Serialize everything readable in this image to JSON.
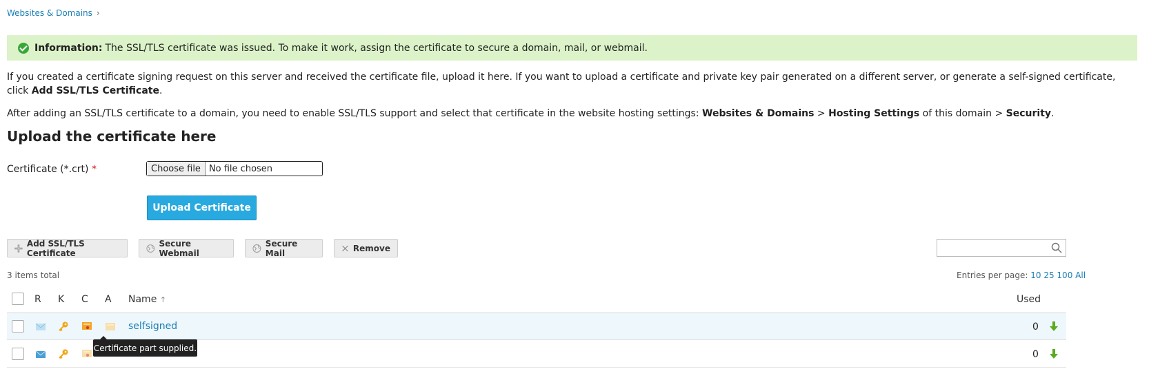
{
  "breadcrumb": {
    "item": "Websites & Domains",
    "sep": "›"
  },
  "info": {
    "label": "Information:",
    "text": "The SSL/TLS certificate was issued. To make it work, assign the certificate to secure a domain, mail, or webmail."
  },
  "intro": {
    "p1_text": "If you created a certificate signing request on this server and received the certificate file, upload it here. If you want to upload a certificate and private key pair generated on a different server, or generate a self-signed certificate, click ",
    "p1_bold": "Add SSL/TLS Certificate",
    "p1_end": ".",
    "p2_a": "After adding an SSL/TLS certificate to a domain, you need to enable SSL/TLS support and select that certificate in the website hosting settings: ",
    "p2_b1": "Websites & Domains",
    "p2_gt1": " > ",
    "p2_b2": "Hosting Settings",
    "p2_mid": " of this domain > ",
    "p2_b3": "Security",
    "p2_end": "."
  },
  "upload": {
    "title": "Upload the certificate here",
    "field_label": "Certificate (*.crt)",
    "required_mark": "*",
    "choose_label": "Choose file",
    "file_status": "No file chosen",
    "button": "Upload Certificate"
  },
  "toolbar": {
    "add": "Add SSL/TLS Certificate",
    "secure_webmail": "Secure Webmail",
    "secure_mail": "Secure Mail",
    "remove": "Remove",
    "search_placeholder": ""
  },
  "list": {
    "total": "3 items total",
    "entries_label": "Entries per page:",
    "entries_options": [
      "10",
      "25",
      "100",
      "All"
    ],
    "columns": {
      "r": "R",
      "k": "K",
      "c": "C",
      "a": "A",
      "name": "Name",
      "sort": "↑",
      "used": "Used"
    },
    "rows": [
      {
        "name": "selfsigned",
        "used": "0"
      },
      {
        "name": "",
        "used": "0"
      }
    ],
    "tooltip": "Certificate part supplied."
  }
}
